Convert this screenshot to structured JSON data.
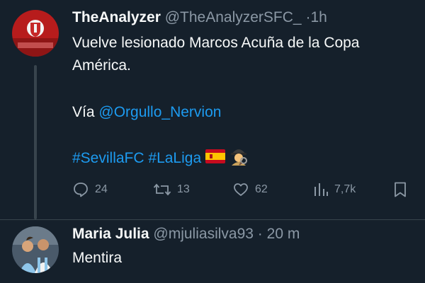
{
  "tweet1": {
    "name": "TheAnalyzer",
    "handle": "@TheAnalyzerSFC_",
    "separator": "·",
    "time": "1h",
    "text_line1": "Vuelve lesionado Marcos Acuña de la Copa",
    "text_line2": "América.",
    "via_prefix": "Vía",
    "via_mention": "@Orgullo_Nervion",
    "hashtag1": "#SevillaFC",
    "hashtag2": "#LaLiga",
    "emojis": [
      "spain-flag-icon",
      "detective-icon"
    ],
    "stats": {
      "replies": "24",
      "retweets": "13",
      "likes": "62",
      "views": "7,7k"
    }
  },
  "tweet2": {
    "name": "Maria Julia",
    "handle": "@mjuliasilva93",
    "separator": "·",
    "time": "20 m",
    "text": "Mentira"
  },
  "colors": {
    "background": "#15202b",
    "accent": "#1d9bf0",
    "secondary_text": "#8b98a5"
  }
}
